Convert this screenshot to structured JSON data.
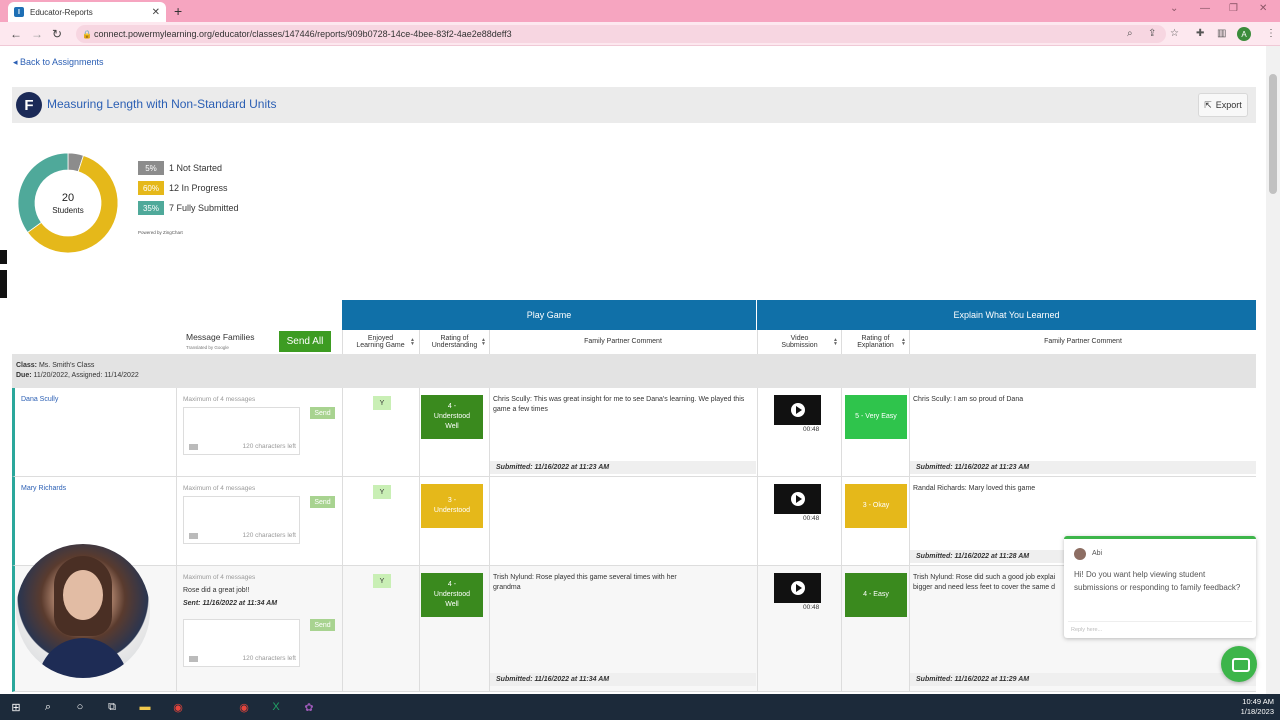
{
  "browser": {
    "tab_title": "Educator-Reports",
    "url": "connect.powermylearning.org/educator/classes/147446/reports/909b0728-14ce-4bee-83f2-4ae2e88deff3",
    "profile_initial": "A"
  },
  "page": {
    "back_link": "◂ Back to Assignments",
    "logo_letter": "F",
    "title": "Measuring Length with Non-Standard Units",
    "export_label": "Export"
  },
  "summary": {
    "total": "20",
    "total_label": "Students",
    "powered_by": "Powered by ZingChart",
    "segments": [
      {
        "pct_label": "5%",
        "label": "1 Not Started",
        "value": 1,
        "color": "#8c8c8c"
      },
      {
        "pct_label": "60%",
        "label": "12 In Progress",
        "value": 12,
        "color": "#e5b81a"
      },
      {
        "pct_label": "35%",
        "label": "7 Fully Submitted",
        "value": 7,
        "color": "#4fa99a"
      }
    ]
  },
  "table": {
    "message_families": "Message Families",
    "translated": "Translated by Google",
    "send_all": "Send All",
    "group_play": "Play Game",
    "group_explain": "Explain What You Learned",
    "col_enjoyed": "Enjoyed Learning Game",
    "col_rating_understanding": "Rating of Understanding",
    "col_family_comment_1": "Family Partner Comment",
    "col_video": "Video Submission",
    "col_rating_explanation": "Rating of Explanation",
    "col_family_comment_2": "Family Partner Comment",
    "class_label": "Class:",
    "class_value": "Ms. Smith's Class",
    "due_label": "Due:",
    "due_value": "11/20/2022, Assigned: 11/14/2022",
    "max_messages": "Maximum of 4 messages",
    "chars_left": "120 characters left",
    "send": "Send",
    "rows": [
      {
        "name": "Dana Scully",
        "sent_message": "",
        "sent_date": "",
        "enjoyed": "Y",
        "understanding": "4 - Understood Well",
        "understanding_color": "#3a8a1e",
        "comment1": "Chris Scully: This was great insight for me to see Dana's learning. We played this game a few times",
        "submitted1": "Submitted: 11/16/2022 at 11:23 AM",
        "video_time": "00:48",
        "explanation": "5 - Very Easy",
        "explanation_color": "#2fc44c",
        "comment2": "Chris Scully: I am so proud of Dana",
        "submitted2": "Submitted: 11/16/2022 at 11:23 AM"
      },
      {
        "name": "Mary Richards",
        "sent_message": "",
        "sent_date": "",
        "enjoyed": "Y",
        "understanding": "3 - Understood",
        "understanding_color": "#e5b81a",
        "comment1": "",
        "submitted1": "",
        "video_time": "00:48",
        "explanation": "3 - Okay",
        "explanation_color": "#e5b81a",
        "comment2": "Randal Richards: Mary loved this game",
        "submitted2": "Submitted: 11/16/2022 at 11:28 AM"
      },
      {
        "name": "",
        "sent_message": "Rose did a great job!!",
        "sent_date": "Sent: 11/16/2022 at 11:34 AM",
        "enjoyed": "Y",
        "understanding": "4 - Understood Well",
        "understanding_color": "#3a8a1e",
        "comment1": "Trish Nylund: Rose played this game several times with her grandma",
        "submitted1": "Submitted: 11/16/2022 at 11:34 AM",
        "video_time": "00:48",
        "explanation": "4 - Easy",
        "explanation_color": "#3a8a1e",
        "comment2": "Trish Nylund: Rose did such a good job explai bigger and need less feet to cover the same d",
        "submitted2": "Submitted: 11/16/2022 at 11:29 AM"
      }
    ]
  },
  "chat": {
    "agent_name": "Abi",
    "message": "Hi! Do you want help viewing student submissions or responding to family feedback?",
    "reply_placeholder": "Reply here..."
  },
  "taskbar": {
    "time": "10:49 AM",
    "date": "1/18/2023"
  }
}
